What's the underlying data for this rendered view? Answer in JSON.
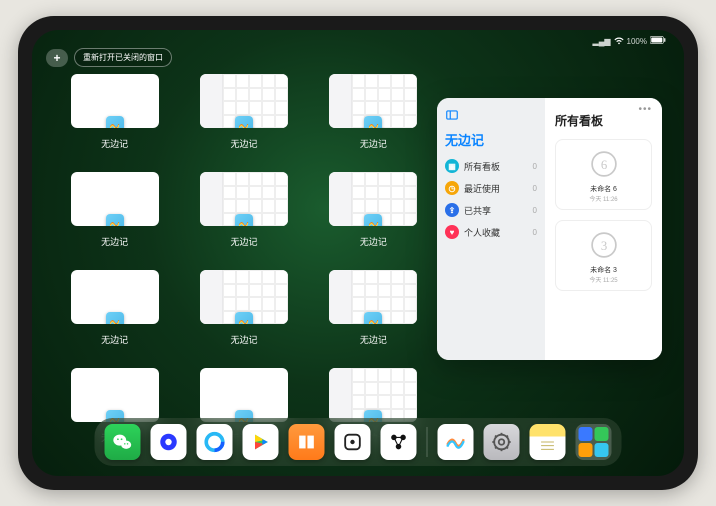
{
  "status": {
    "battery": "100%",
    "signal_icon": "signal-icon",
    "wifi_icon": "wifi-icon"
  },
  "toolbar": {
    "add_label": "+",
    "reopen_label": "重新打开已关闭的窗口"
  },
  "thumb_app_name": "无边记",
  "thumbnails": [
    {
      "type": "blank"
    },
    {
      "type": "cal"
    },
    {
      "type": "cal"
    },
    {
      "type": "blank"
    },
    {
      "type": "cal"
    },
    {
      "type": "cal"
    },
    {
      "type": "blank"
    },
    {
      "type": "cal"
    },
    {
      "type": "cal"
    },
    {
      "type": "blank"
    },
    {
      "type": "blank"
    },
    {
      "type": "cal"
    }
  ],
  "panel": {
    "left_title": "无边记",
    "right_title": "所有看板",
    "items": [
      {
        "label": "所有看板",
        "count": 0,
        "color": "#12b5d6"
      },
      {
        "label": "最近使用",
        "count": 0,
        "color": "#f6a609"
      },
      {
        "label": "已共享",
        "count": 0,
        "color": "#2a6fe8"
      },
      {
        "label": "个人收藏",
        "count": 0,
        "color": "#ff3257"
      }
    ],
    "boards": [
      {
        "name": "未命名 6",
        "sub": "今天 11:26",
        "digit": "6"
      },
      {
        "name": "未命名 3",
        "sub": "今天 11:25",
        "digit": "3"
      }
    ]
  },
  "dock": {
    "items": [
      {
        "name": "wechat",
        "bg": "linear-gradient(#2dd35a,#1fab46)"
      },
      {
        "name": "hd-app",
        "bg": "#ffffff"
      },
      {
        "name": "browser",
        "bg": "#ffffff"
      },
      {
        "name": "play",
        "bg": "#ffffff"
      },
      {
        "name": "books",
        "bg": "linear-gradient(#ff9a3d,#ff7a1a)"
      },
      {
        "name": "dice",
        "bg": "#ffffff"
      },
      {
        "name": "nodes",
        "bg": "#ffffff"
      }
    ],
    "recent": [
      {
        "name": "freeform",
        "bg": "#ffffff"
      },
      {
        "name": "settings",
        "bg": "linear-gradient(#d8d8db,#b9b9bd)"
      },
      {
        "name": "notes",
        "bg": "linear-gradient(#ffe26b 35%, #fff 35%)"
      }
    ]
  },
  "colors": {
    "accent": "#0a84ff"
  }
}
